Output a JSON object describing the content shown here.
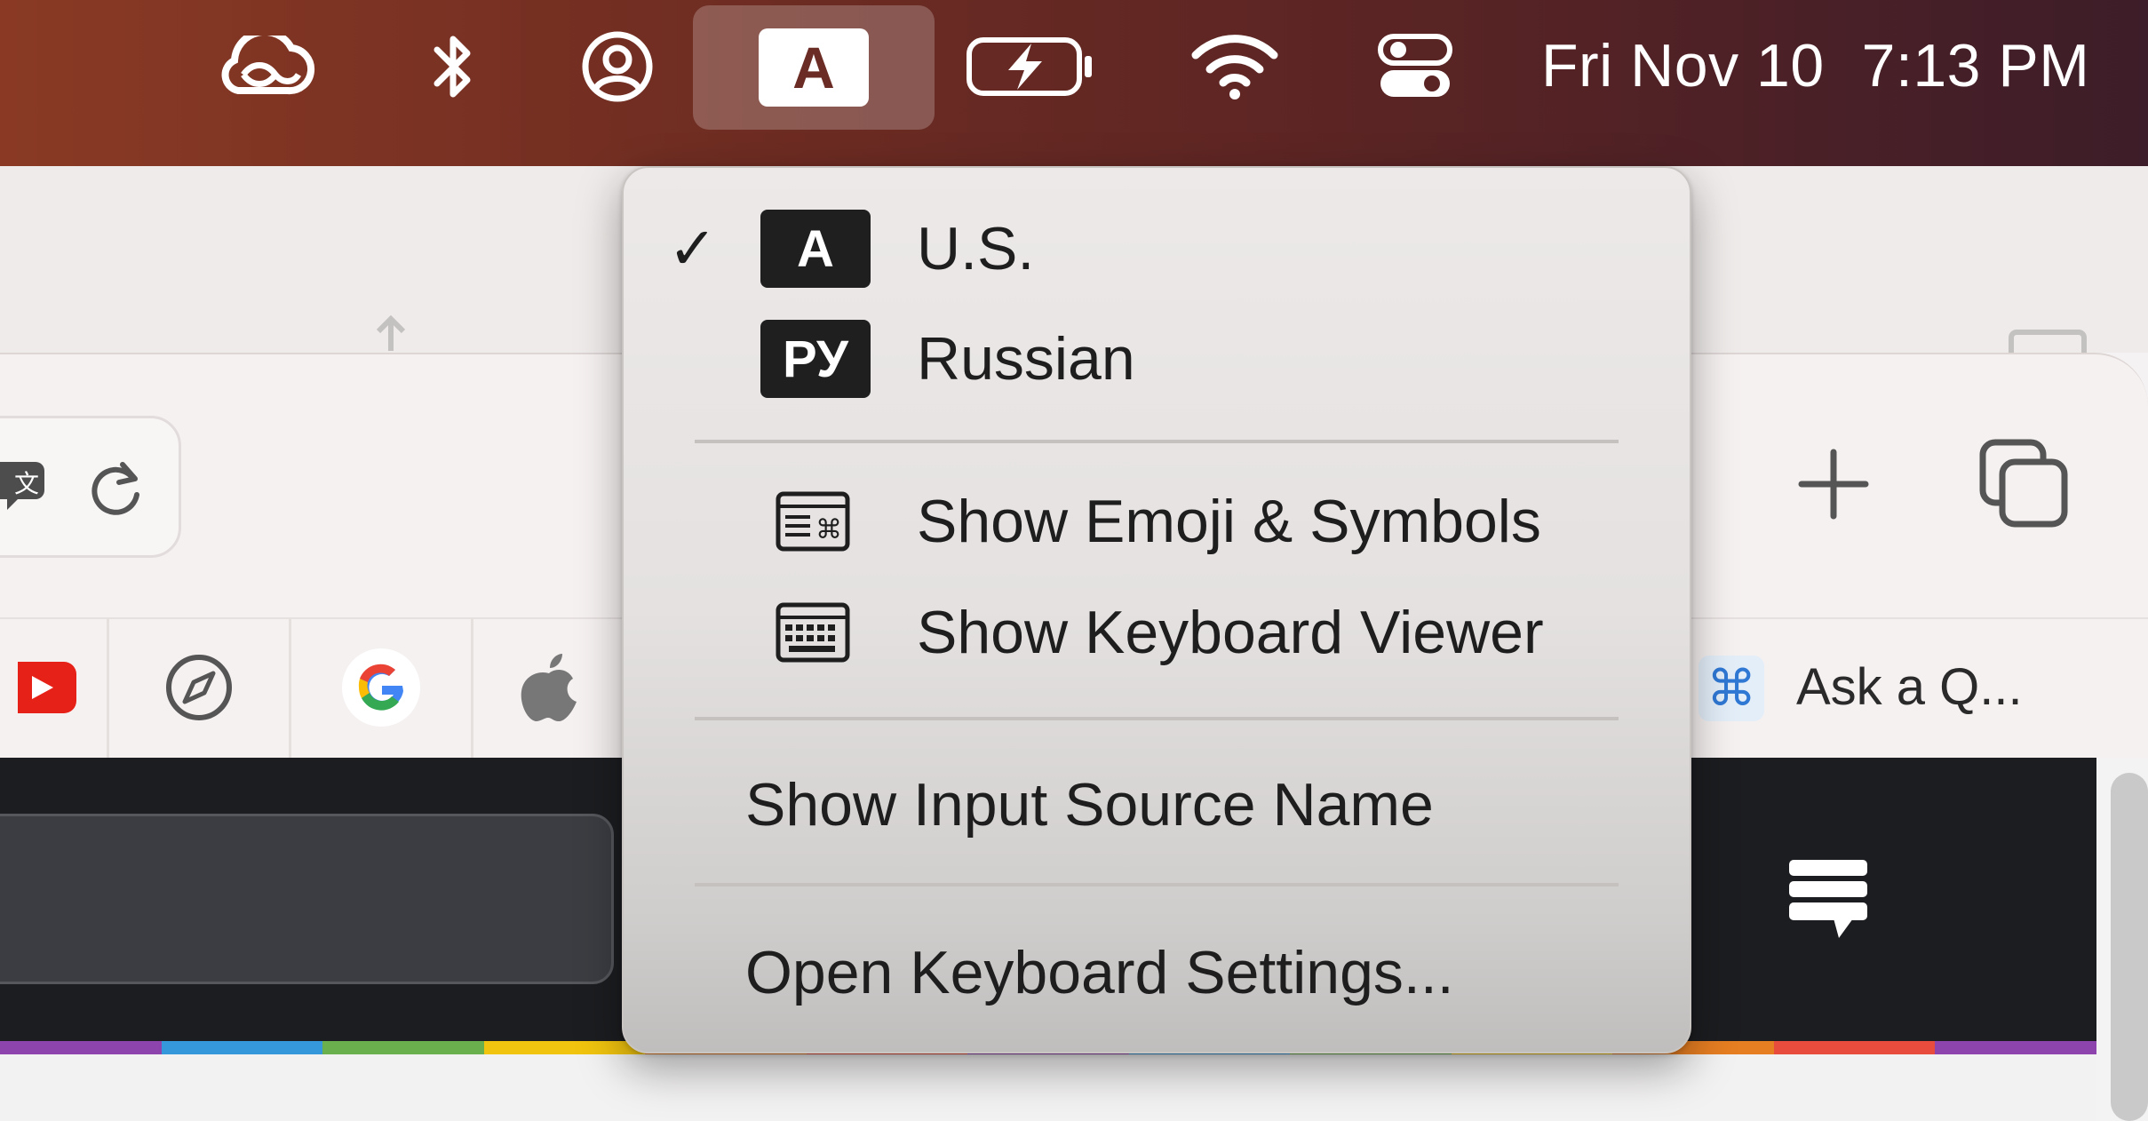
{
  "menubar": {
    "icons": [
      "creative-cloud-icon",
      "bluetooth-icon",
      "user-account-icon",
      "input-source-icon",
      "battery-charging-icon",
      "wifi-icon",
      "control-center-icon"
    ],
    "input_source_badge": "A",
    "clock_day": "Fri Nov 10",
    "clock_time": "7:13 PM"
  },
  "browser": {
    "toolbar_icons": [
      "translate-icon",
      "reload-icon",
      "new-tab-icon",
      "tab-overview-icon"
    ],
    "bookmarks": [
      "youtube-icon",
      "compass-icon",
      "google-icon",
      "apple-icon"
    ],
    "ask_bookmark": "Ask a Q...",
    "ask_bookmark_badge": "⌘",
    "rainbow_colors": [
      "#8e44ad",
      "#3498db",
      "#6ab04c",
      "#f1c40f",
      "#e67e22",
      "#e74c3c",
      "#8e44ad",
      "#3498db",
      "#6ab04c",
      "#f1c40f",
      "#e67e22",
      "#e74c3c",
      "#8e44ad"
    ]
  },
  "menu": {
    "sources": [
      {
        "badge": "A",
        "label": "U.S.",
        "checked": true,
        "check": "✓"
      },
      {
        "badge": "РУ",
        "label": "Russian",
        "checked": false
      }
    ],
    "tools": [
      {
        "icon": "emoji-symbols-icon",
        "label": "Show Emoji & Symbols"
      },
      {
        "icon": "keyboard-viewer-icon",
        "label": "Show Keyboard Viewer"
      }
    ],
    "show_input_source_name": "Show Input Source Name",
    "open_keyboard_settings": "Open Keyboard Settings..."
  }
}
